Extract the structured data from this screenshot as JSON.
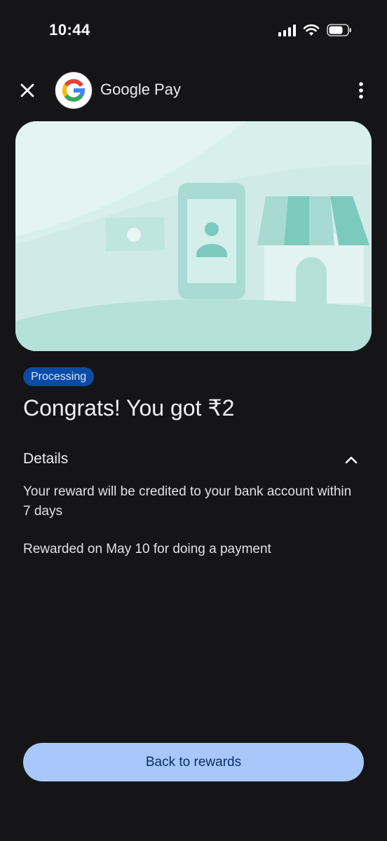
{
  "status_bar": {
    "time": "10:44",
    "icons": [
      "signal-icon",
      "wifi-icon",
      "battery-icon"
    ]
  },
  "header": {
    "close_icon": "close-icon",
    "logo_letter": "G",
    "app_name": "Google Pay",
    "more_icon": "more-vertical-icon"
  },
  "reward": {
    "status_badge": "Processing",
    "headline": "Congrats! You got ₹2"
  },
  "details": {
    "label": "Details",
    "chevron_icon": "chevron-up-icon",
    "expanded": true,
    "description": "Your reward will be credited to your bank account within 7 days",
    "rewarded_on": "Rewarded on May 10 for doing a payment"
  },
  "cta": {
    "label": "Back to rewards"
  },
  "colors": {
    "background": "#151517",
    "badge_bg": "#0b4ba6",
    "cta_bg": "#a8c7fa",
    "hero_bg": "#d7efec"
  }
}
